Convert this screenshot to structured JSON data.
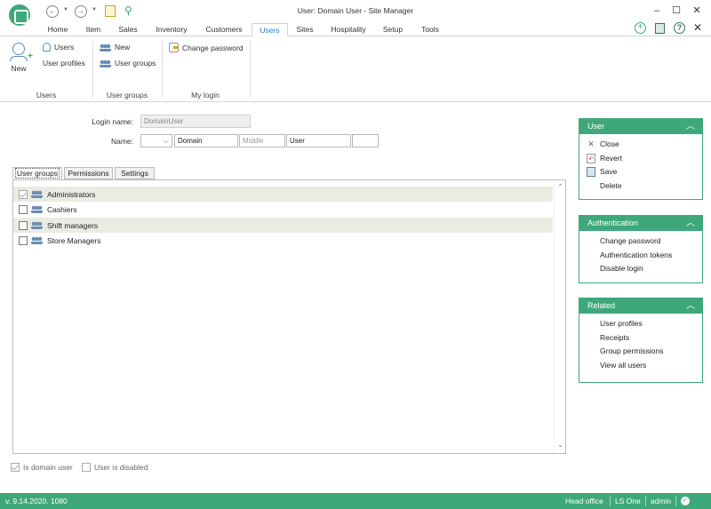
{
  "window": {
    "title": "User: Domain User - Site Manager"
  },
  "menu_tabs": [
    {
      "label": "Home"
    },
    {
      "label": "Item"
    },
    {
      "label": "Sales"
    },
    {
      "label": "Inventory"
    },
    {
      "label": "Customers"
    },
    {
      "label": "Users"
    },
    {
      "label": "Sites"
    },
    {
      "label": "Hospitality"
    },
    {
      "label": "Setup"
    },
    {
      "label": "Tools"
    }
  ],
  "active_tab": "Users",
  "ribbon": {
    "users_group": {
      "new_label": "New",
      "users_label": "Users",
      "profiles_label": "User profiles",
      "group_label": "Users"
    },
    "usergroups_group": {
      "new_label": "New",
      "groups_label": "User groups",
      "group_label": "User groups"
    },
    "mylogin_group": {
      "change_password_label": "Change password",
      "group_label": "My login"
    }
  },
  "form": {
    "login_label": "Login name:",
    "login_value": "DomainUser",
    "name_label": "Name:",
    "first_value": "Domain",
    "middle_placeholder": "Middle",
    "last_value": "User",
    "suffix_value": ""
  },
  "page_tabs": [
    {
      "label": "User groups"
    },
    {
      "label": "Permissions"
    },
    {
      "label": "Settings"
    }
  ],
  "user_groups": [
    {
      "label": "Administrators",
      "checked": true
    },
    {
      "label": "Cashiers",
      "checked": false
    },
    {
      "label": "Shift managers",
      "checked": false
    },
    {
      "label": "Store Managers",
      "checked": false
    }
  ],
  "bottom_checks": {
    "domain_label": "Is domain user",
    "disabled_label": "User is disabled"
  },
  "panels": {
    "user": {
      "title": "User",
      "items": [
        "Close",
        "Revert",
        "Save",
        "Delete"
      ]
    },
    "authentication": {
      "title": "Authentication",
      "items": [
        "Change password",
        "Authentication tokens",
        "Disable login"
      ]
    },
    "related": {
      "title": "Related",
      "items": [
        "User profiles",
        "Receipts",
        "Group permissions",
        "View all users"
      ]
    }
  },
  "status": {
    "version": "v. 9.14.2020. 1080",
    "site": "Head office",
    "product": "LS One",
    "user": "admin"
  },
  "colors": {
    "accent": "#3ea87a",
    "tab_active_text": "#2b7fc7"
  }
}
